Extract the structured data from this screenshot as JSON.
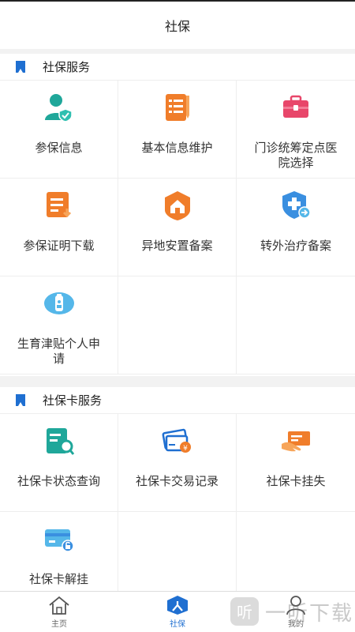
{
  "header": {
    "title": "社保"
  },
  "social_services": {
    "title": "社保服务",
    "items": [
      {
        "label": "参保信息",
        "icon": "person-shield-icon"
      },
      {
        "label": "基本信息维护",
        "icon": "document-edit-icon"
      },
      {
        "label": "门诊统筹定点医院选择",
        "icon": "medical-kit-icon"
      },
      {
        "label": "参保证明下载",
        "icon": "document-download-icon"
      },
      {
        "label": "异地安置备案",
        "icon": "house-icon"
      },
      {
        "label": "转外治疗备案",
        "icon": "medical-transfer-icon"
      },
      {
        "label": "生育津贴个人申请",
        "icon": "baby-bottle-icon"
      }
    ]
  },
  "card_services": {
    "title": "社保卡服务",
    "items": [
      {
        "label": "社保卡状态查询",
        "icon": "card-search-icon"
      },
      {
        "label": "社保卡交易记录",
        "icon": "card-yen-icon"
      },
      {
        "label": "社保卡挂失",
        "icon": "card-report-loss-icon"
      },
      {
        "label": "社保卡解挂",
        "icon": "card-unlock-icon"
      }
    ]
  },
  "tabbar": {
    "items": [
      {
        "label": "主页",
        "icon": "home-icon"
      },
      {
        "label": "社保",
        "icon": "social-security-icon"
      },
      {
        "label": "我的",
        "icon": "profile-icon"
      }
    ],
    "active_index": 1
  },
  "watermark": {
    "text": "一听下载"
  },
  "colors": {
    "accent": "#1f6fd1",
    "teal": "#1fa79a",
    "orange": "#f07d2a",
    "pink": "#e8466a",
    "light_blue": "#55b7e9"
  }
}
